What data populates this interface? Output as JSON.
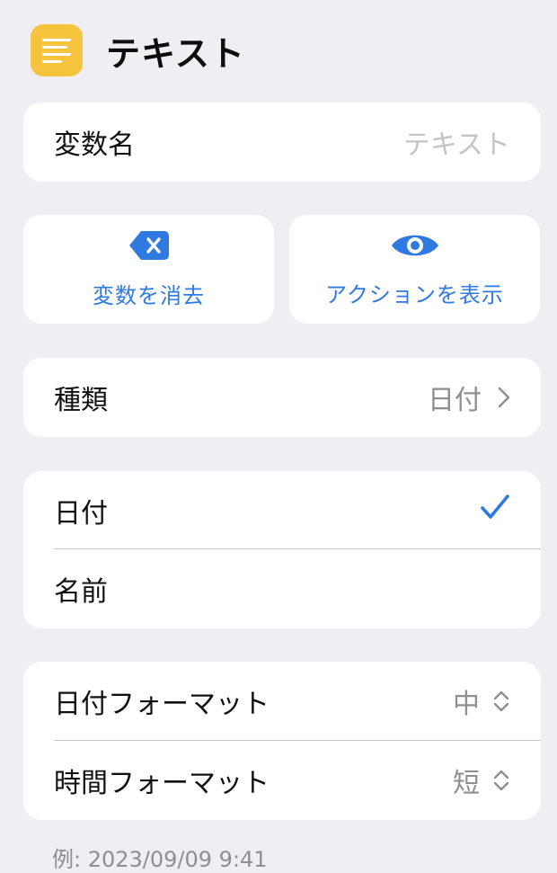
{
  "header": {
    "title": "テキスト",
    "icon": "text-lines-icon"
  },
  "variable_name": {
    "label": "変数名",
    "placeholder": "テキスト"
  },
  "actions": [
    {
      "label": "変数を消去",
      "icon": "delete-left-icon"
    },
    {
      "label": "アクションを表示",
      "icon": "eye-icon"
    }
  ],
  "type_row": {
    "label": "種類",
    "value": "日付"
  },
  "options": [
    {
      "label": "日付",
      "selected": true
    },
    {
      "label": "名前",
      "selected": false
    }
  ],
  "formats": [
    {
      "label": "日付フォーマット",
      "value": "中"
    },
    {
      "label": "時間フォーマット",
      "value": "短"
    }
  ],
  "example": "例: 2023/09/09 9:41",
  "colors": {
    "accent": "#2f7ae0",
    "app_icon": "#f6c33c",
    "background": "#eeeef3"
  }
}
